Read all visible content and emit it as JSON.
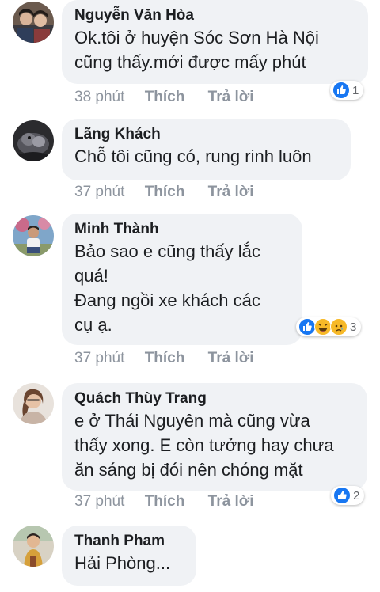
{
  "comments": [
    {
      "author": "Nguyễn Văn Hòa",
      "lines": [
        "Ok.tôi ở huyện Sóc Sơn Hà Nội",
        "cũng thấy.mới được mấy phút"
      ],
      "time": "38 phút",
      "like_label": "Thích",
      "reply_label": "Trả lời",
      "reactions": {
        "icons": [
          "like-icon"
        ],
        "count": "1"
      }
    },
    {
      "author": "Lãng Khách",
      "lines": [
        "Chỗ tôi cũng có, rung rinh luôn"
      ],
      "time": "37 phút",
      "like_label": "Thích",
      "reply_label": "Trả lời"
    },
    {
      "author": "Minh Thành",
      "lines": [
        "Bảo sao e cũng thấy lắc",
        "quá!",
        "Đang ngồi xe khách các",
        "cụ ạ."
      ],
      "time": "37 phút",
      "like_label": "Thích",
      "reply_label": "Trả lời",
      "reactions": {
        "icons": [
          "like-icon",
          "haha-icon",
          "sad-icon"
        ],
        "count": "3"
      }
    },
    {
      "author": "Quách Thùy Trang",
      "lines": [
        "e ở Thái Nguyên mà cũng vừa",
        "thấy xong. E còn tưởng hay chưa",
        "ăn sáng bị đói nên chóng mặt"
      ],
      "time": "37 phút",
      "like_label": "Thích",
      "reply_label": "Trả lời",
      "reactions": {
        "icons": [
          "like-icon"
        ],
        "count": "2"
      }
    },
    {
      "author": "Thanh Pham",
      "lines": [
        "Hải Phòng..."
      ]
    }
  ],
  "colors": {
    "like_blue": "#1877f2",
    "haha_yellow": "#f7b928",
    "bubble_gray": "#f0f2f5",
    "meta_gray": "#8d949e"
  }
}
